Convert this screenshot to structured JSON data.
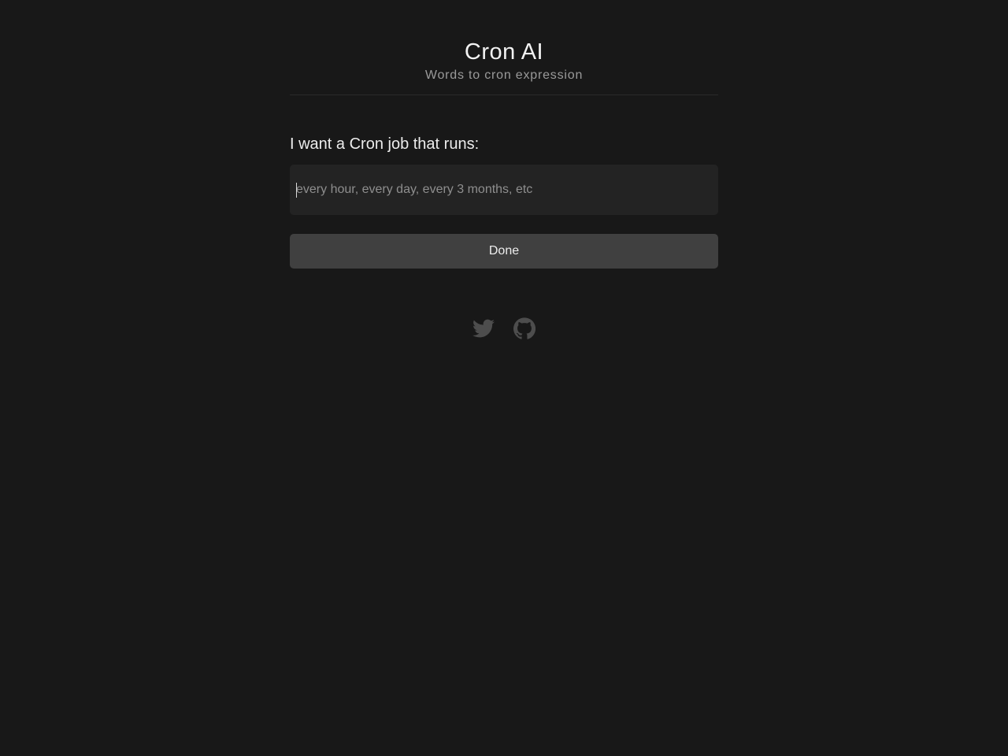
{
  "header": {
    "title": "Cron AI",
    "subtitle": "Words to cron expression"
  },
  "form": {
    "label": "I want a Cron job that runs:",
    "input_value": "",
    "input_placeholder": "every hour, every day, every 3 months, etc",
    "submit_label": "Done"
  },
  "socials": [
    {
      "icon": "twitter-icon"
    },
    {
      "icon": "github-icon"
    }
  ],
  "colors": {
    "background": "#181818",
    "input_background": "#232323",
    "button_background": "#404040",
    "icon_color": "#4d4d4d"
  }
}
